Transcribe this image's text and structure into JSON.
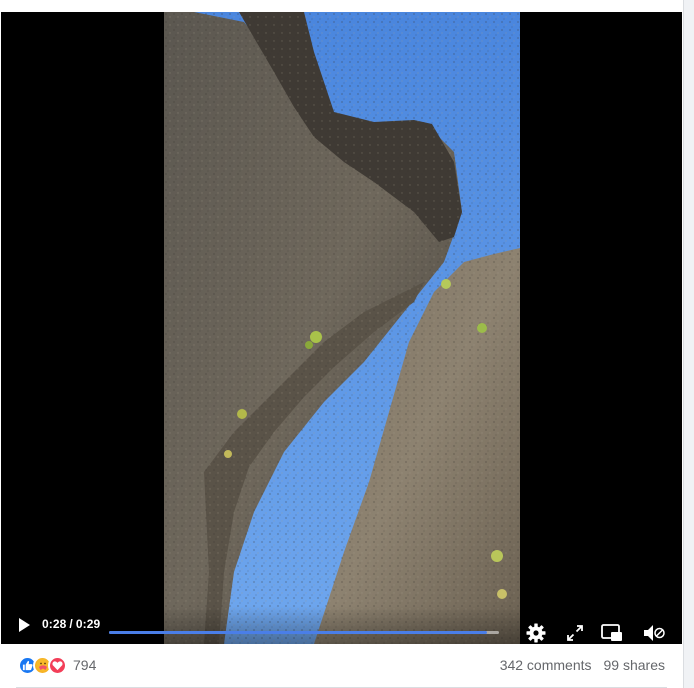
{
  "video": {
    "current_time": "0:28",
    "separator": "/",
    "duration": "0:29",
    "progress_fraction": 0.97,
    "progress_color": "#4a7ee8"
  },
  "controls": {
    "icons": [
      "play-icon",
      "gear-icon",
      "fullscreen-icon",
      "picture-in-picture-icon",
      "volume-muted-icon"
    ]
  },
  "reactions": {
    "icons": [
      "like-icon",
      "care-icon",
      "love-icon"
    ],
    "count": "794"
  },
  "stats": {
    "comments": "342 comments",
    "shares": "99 shares"
  }
}
